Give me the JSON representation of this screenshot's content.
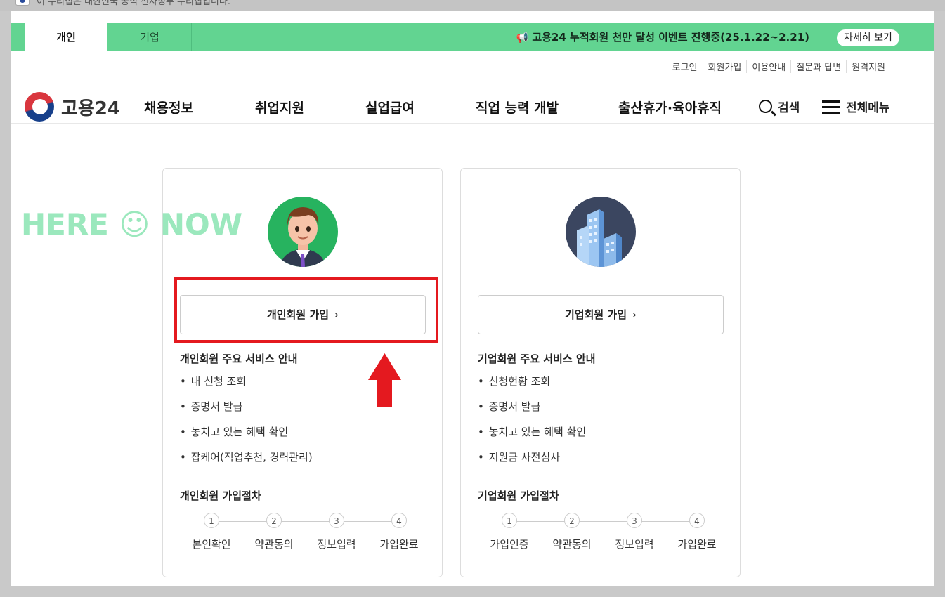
{
  "gov_notice": "이 누리집은 대한민국 공식 전자정부 누리집입니다.",
  "tabs": [
    {
      "label": "개인",
      "active": true
    },
    {
      "label": "기업",
      "active": false
    }
  ],
  "event": {
    "icon": "megaphone-icon",
    "text": "고용24 누적회원 천만 달성 이벤트 진행중(25.1.22~2.21)",
    "button": "자세히 보기"
  },
  "util_links": [
    "로그인",
    "회원가입",
    "이용안내",
    "질문과 답변",
    "원격지원"
  ],
  "logo": {
    "text": "고용24"
  },
  "gnb": [
    "채용정보",
    "취업지원",
    "실업급여",
    "직업 능력 개발",
    "출산휴가·육아휴직"
  ],
  "search": {
    "label": "검색",
    "icon": "search-icon"
  },
  "all_menu": {
    "label": "전체메뉴",
    "icon": "hamburger-icon"
  },
  "watermark": "HERE ☺ NOW",
  "cards": [
    {
      "avatar": "person-avatar",
      "button": "개인회원 가입",
      "services_title": "개인회원 주요 서비스 안내",
      "services": [
        "내 신청 조회",
        "증명서 발급",
        "놓치고 있는 혜택 확인",
        "잡케어(직업추천, 경력관리)"
      ],
      "steps_title": "개인회원 가입절차",
      "steps": [
        {
          "num": "1",
          "label": "본인확인"
        },
        {
          "num": "2",
          "label": "약관동의"
        },
        {
          "num": "3",
          "label": "정보입력"
        },
        {
          "num": "4",
          "label": "가입완료"
        }
      ]
    },
    {
      "avatar": "building-avatar",
      "button": "기업회원 가입",
      "services_title": "기업회원 주요 서비스 안내",
      "services": [
        "신청현황 조회",
        "증명서 발급",
        "놓치고 있는 혜택 확인",
        "지원금 사전심사"
      ],
      "steps_title": "기업회원 가입절차",
      "steps": [
        {
          "num": "1",
          "label": "가입인증"
        },
        {
          "num": "2",
          "label": "약관동의"
        },
        {
          "num": "3",
          "label": "정보입력"
        },
        {
          "num": "4",
          "label": "가입완료"
        }
      ]
    }
  ],
  "colors": {
    "topbar": "#62d491",
    "highlight": "#e4191f",
    "watermark": "#9be8bd"
  }
}
